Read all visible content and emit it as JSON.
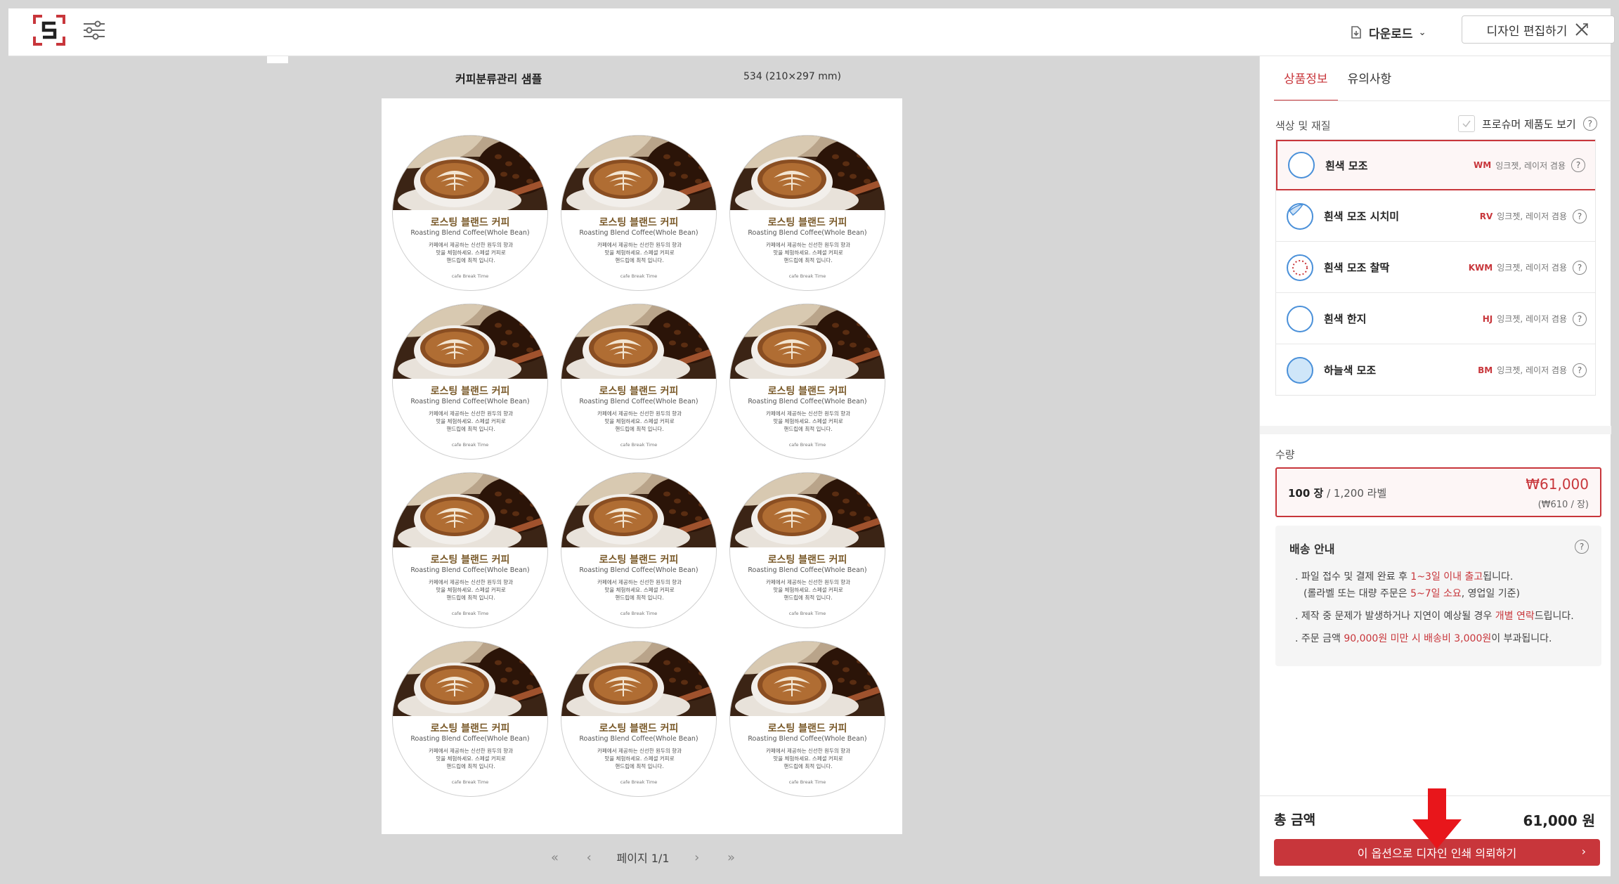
{
  "header": {
    "download_label": "다운로드",
    "edit_label": "디자인 편집하기"
  },
  "document": {
    "title": "커피분류관리 샘플",
    "size": "534 (210×297 mm)"
  },
  "label_design": {
    "title": "로스팅 블랜드 커피",
    "subtitle": "Roasting Blend Coffee(Whole Bean)",
    "desc1": "카페에서 제공하는 신선한 원두의 향과",
    "desc2": "맛을 체험하세요. 스페셜 커피로",
    "desc3": "핸드립에 최적 입니다.",
    "footer": "cafe Break Time"
  },
  "pager": {
    "text": "페이지 1/1"
  },
  "panel": {
    "tabs": [
      "상품정보",
      "유의사항"
    ],
    "material_section_label": "색상 및 재질",
    "prosumer_label": "프로슈머 제품도 보기",
    "materials": [
      {
        "name": "흰색 모조",
        "code": "WM",
        "desc": "잉크젯, 레이저 겸용"
      },
      {
        "name": "흰색 모조 시치미",
        "code": "RV",
        "desc": "잉크젯, 레이저 겸용"
      },
      {
        "name": "흰색 모조 찰딱",
        "code": "KWM",
        "desc": "잉크젯, 레이저 겸용"
      },
      {
        "name": "흰색 한지",
        "code": "HJ",
        "desc": "잉크젯, 레이저 겸용"
      },
      {
        "name": "하늘색 모조",
        "code": "BM",
        "desc": "잉크젯, 레이저 겸용"
      }
    ],
    "quantity": {
      "label": "수량",
      "count": "100 장",
      "detail": " / 1,200 라벨",
      "price": "₩61,000",
      "unit_price": "(₩610 / 장)"
    },
    "shipping": {
      "title": "배송 안내",
      "l1_a": ". 파일 접수 및 결제 완료 후 ",
      "l1_b": "1~3일 이내 출고",
      "l1_c": "됩니다.",
      "l2_a": "(롤라벨 또는 대량 주문은 ",
      "l2_b": "5~7일 소요",
      "l2_c": ", 영업일 기준)",
      "l3_a": ". 제작 중 문제가 발생하거나 지연이 예상될 경우 ",
      "l3_b": "개별 연락",
      "l3_c": "드립니다.",
      "l4_a": ". 주문 금액 ",
      "l4_b": "90,000원 미만 시 배송비 3,000원",
      "l4_c": "이 부과됩니다."
    },
    "total_label": "총 금액",
    "total_value": "61,000 원",
    "order_label": "이 옵션으로 디자인 인쇄 의뢰하기"
  },
  "colors": {
    "accent": "#c8363b",
    "canvas_bg": "#d6d6d6"
  }
}
